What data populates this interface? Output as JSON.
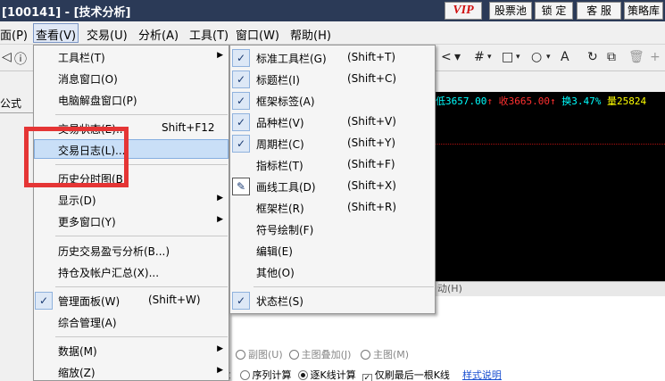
{
  "window": {
    "title": "[100141] - [技术分析]",
    "buttons": {
      "vip": "VIP",
      "stock_pool": "股票池",
      "lock": "锁 定",
      "service": "客 服",
      "strategy": "策略库"
    }
  },
  "menubar": [
    {
      "label": "面(P)"
    },
    {
      "label": "查看(V)",
      "active": true
    },
    {
      "label": "交易(U)"
    },
    {
      "label": "分析(A)"
    },
    {
      "label": "工具(T)"
    },
    {
      "label": "窗口(W)"
    },
    {
      "label": "帮助(H)"
    }
  ],
  "toolbar": {
    "left_icons": [
      "info-icon",
      "flag-icon"
    ],
    "right_icons": [
      "grid-icon",
      "rect-icon",
      "circle-icon",
      "text-icon",
      "refresh-icon",
      "copy-icon",
      "delete-icon"
    ]
  },
  "left_strip": {
    "label": "公式"
  },
  "quote_bar": {
    "low": "低3657.00",
    "close": "收3665.00",
    "turnover": "换3.47%",
    "volume": "量25824",
    "colors": {
      "low": "#00ffff",
      "close": "#ff3030",
      "turnover": "#00ffff",
      "volume": "#ffff00"
    }
  },
  "panel_bar": {
    "text": "动(H)"
  },
  "bottom_options": {
    "row1": {
      "sub": "副图(U)",
      "main_overlay": "主图叠加(J)",
      "main": "主图(M)"
    },
    "row2": {
      "prefix": "：",
      "seq": "序列计算",
      "line": "逐K线计算",
      "last_only": "仅刷最后一根K线",
      "style_help": "样式说明"
    }
  },
  "view_menu": {
    "items": [
      {
        "label": "工具栏(T)",
        "shortcut": "",
        "submenu": true
      },
      {
        "label": "消息窗口(O)",
        "shortcut": ""
      },
      {
        "label": "电脑解盘窗口(P)",
        "shortcut": ""
      },
      {
        "label": "交易状态(E)...",
        "shortcut": "Shift+F12"
      },
      {
        "label": "交易日志(L)...",
        "shortcut": ""
      },
      {
        "label": "历史分时图(B)",
        "shortcut": ""
      },
      {
        "label": "显示(D)",
        "shortcut": "",
        "submenu": true
      },
      {
        "label": "更多窗口(Y)",
        "shortcut": "",
        "submenu": true
      },
      {
        "label": "历史交易盈亏分析(B...)",
        "shortcut": ""
      },
      {
        "label": "持仓及帐户汇总(X)...",
        "shortcut": ""
      },
      {
        "label": "管理面板(W)",
        "shortcut": "(Shift+W)",
        "checked": true
      },
      {
        "label": "综合管理(A)",
        "shortcut": ""
      },
      {
        "label": "数据(M)",
        "shortcut": "",
        "submenu": true
      },
      {
        "label": "缩放(Z)",
        "shortcut": "",
        "submenu": true
      }
    ]
  },
  "toolbar_submenu": {
    "items": [
      {
        "label": "标准工具栏(G)",
        "shortcut": "(Shift+T)",
        "checked": true
      },
      {
        "label": "标题栏(I)",
        "shortcut": "(Shift+C)",
        "checked": true
      },
      {
        "label": "框架标签(A)",
        "shortcut": "",
        "checked": true
      },
      {
        "label": "品种栏(V)",
        "shortcut": "(Shift+V)",
        "checked": true
      },
      {
        "label": "周期栏(C)",
        "shortcut": "(Shift+Y)",
        "checked": true
      },
      {
        "label": "指标栏(T)",
        "shortcut": "(Shift+F)",
        "checked": false
      },
      {
        "label": "画线工具(D)",
        "shortcut": "(Shift+X)",
        "checked": false,
        "pen": true
      },
      {
        "label": "框架栏(R)",
        "shortcut": "(Shift+R)",
        "checked": false
      },
      {
        "label": "符号绘制(F)",
        "shortcut": "",
        "checked": false
      },
      {
        "label": "编辑(E)",
        "shortcut": "",
        "checked": false
      },
      {
        "label": "其他(O)",
        "shortcut": "",
        "checked": false
      },
      {
        "label": "状态栏(S)",
        "shortcut": "",
        "checked": true
      }
    ]
  },
  "annotation": {
    "color": "#e53535"
  }
}
